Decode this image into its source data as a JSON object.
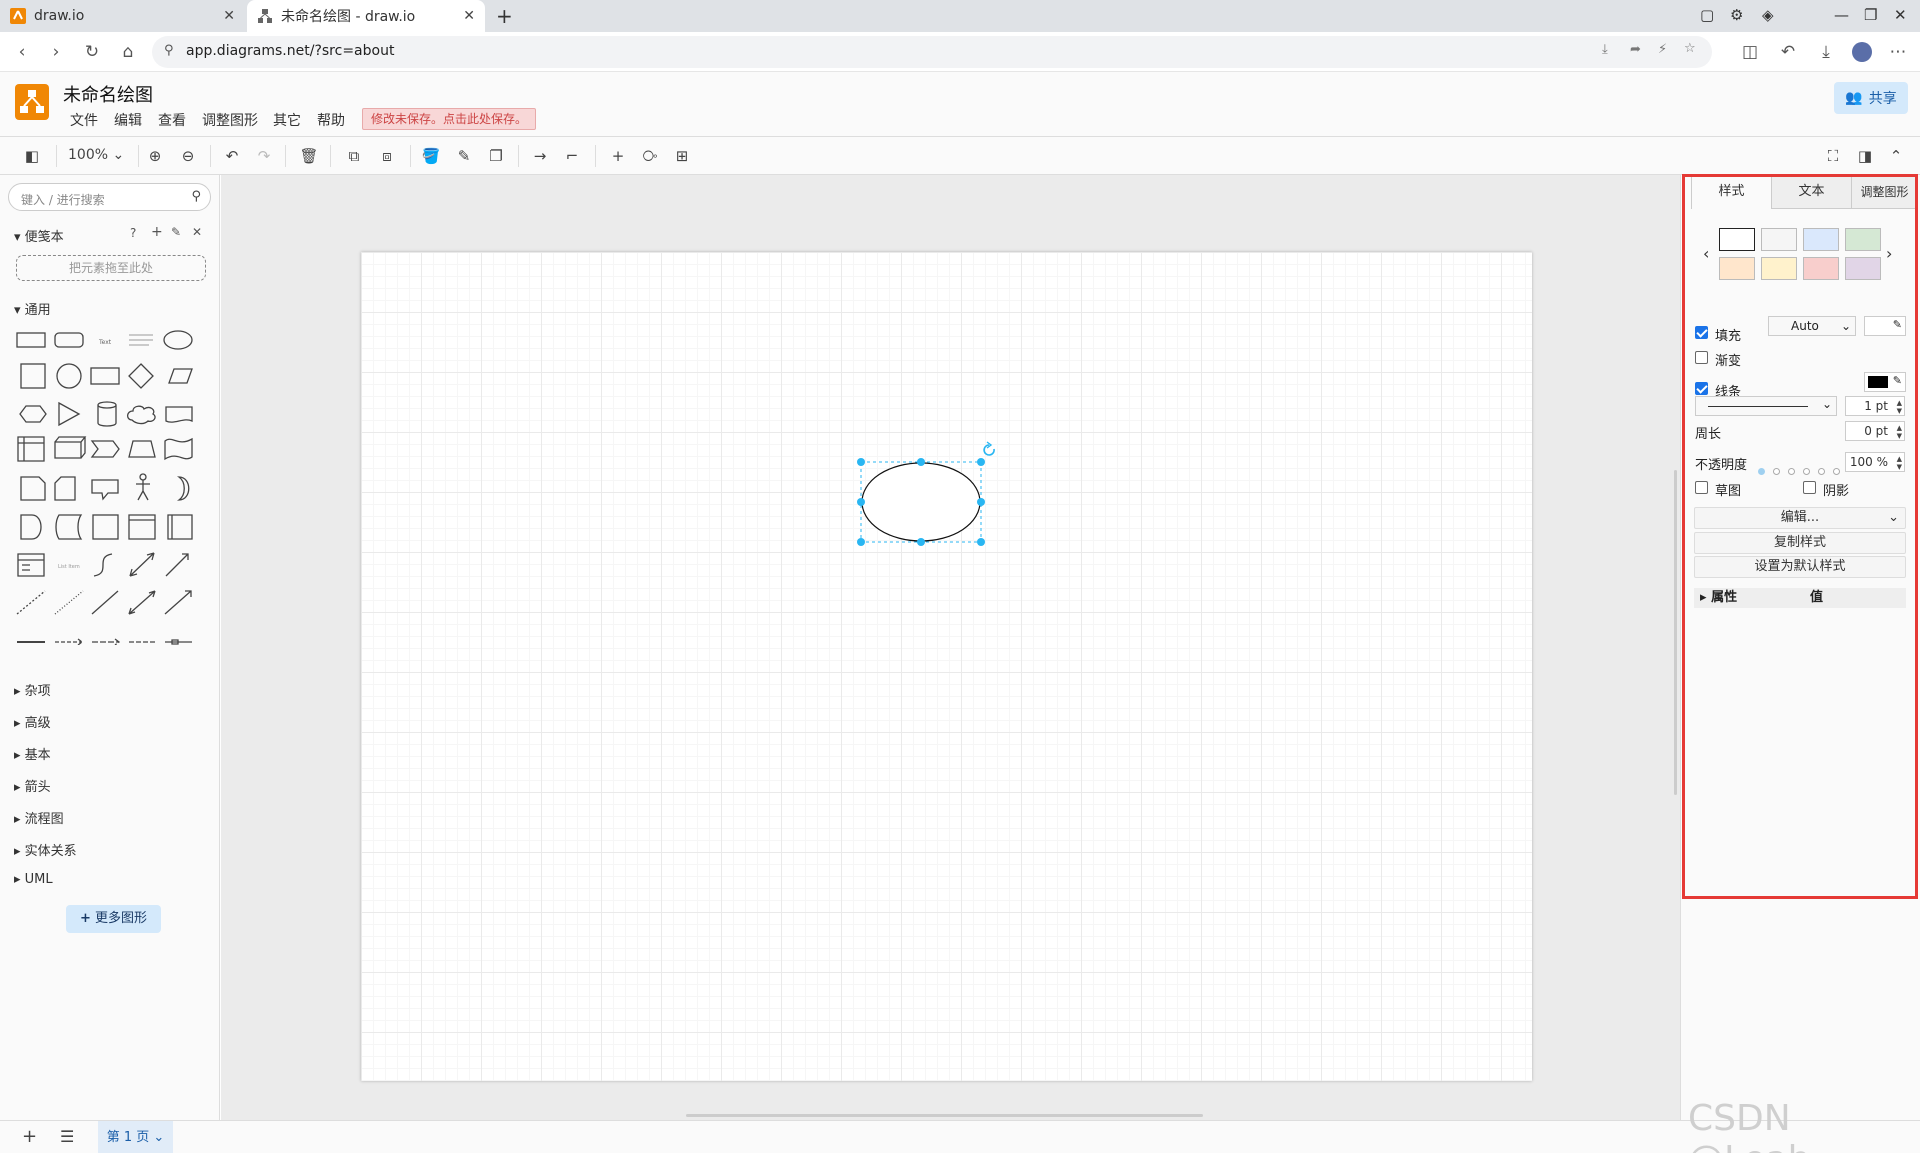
{
  "browser": {
    "tabs": [
      {
        "title": "draw.io"
      },
      {
        "title": "未命名绘图 - draw.io"
      }
    ],
    "url": "app.diagrams.net/?src=about"
  },
  "app": {
    "doc_title": "未命名绘图",
    "menus": [
      "文件",
      "编辑",
      "查看",
      "调整图形",
      "其它",
      "帮助"
    ],
    "unsaved_notice": "修改未保存。点击此处保存。",
    "share_label": "共享"
  },
  "toolbar": {
    "zoom": "100%"
  },
  "sidebar": {
    "search_placeholder": "键入 / 进行搜索",
    "scratchpad_title": "便笺本",
    "scratchpad_drop": "把元素拖至此处",
    "general_title": "通用",
    "libraries": [
      "杂项",
      "高级",
      "基本",
      "箭头",
      "流程图",
      "实体关系",
      "UML"
    ],
    "more_shapes": "更多图形"
  },
  "format_panel": {
    "tabs": [
      "样式",
      "文本",
      "调整图形"
    ],
    "fill_label": "填充",
    "fill_value": "Auto",
    "gradient_label": "渐变",
    "line_label": "线条",
    "line_width": "1 pt",
    "perimeter_label": "周长",
    "perimeter_value": "0 pt",
    "opacity_label": "不透明度",
    "opacity_value": "100 %",
    "sketch_label": "草图",
    "shadow_label": "阴影",
    "edit_label": "编辑...",
    "copy_style": "复制样式",
    "set_default": "设置为默认样式",
    "prop_header": "属性",
    "value_header": "值",
    "swatches": [
      "#ffffff",
      "#f5f5f5",
      "#dae8fc",
      "#d5e8d4",
      "#ffe6cc",
      "#fff2cc",
      "#f8cecc",
      "#e1d5e7"
    ]
  },
  "footer": {
    "page_tab": "第 1 页"
  },
  "watermark": "CSDN @Leah-"
}
